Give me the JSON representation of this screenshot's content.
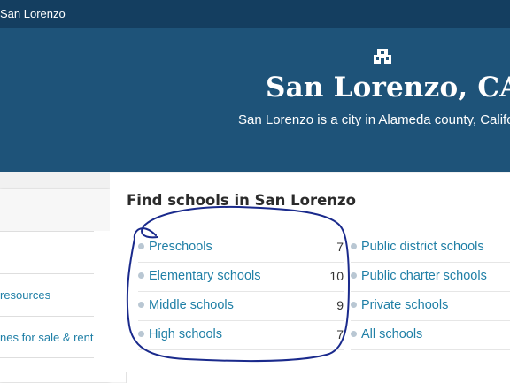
{
  "topbar": {
    "breadcrumb": "San Lorenzo"
  },
  "hero": {
    "icon": "school-building-icon",
    "title": "San Lorenzo, CA",
    "subtitle": "San Lorenzo is a city in Alameda county, Califor"
  },
  "sidebar": {
    "links": [
      "resources",
      "nes for sale & rent"
    ]
  },
  "main": {
    "heading": "Find schools in San Lorenzo",
    "levels": [
      {
        "label": "Preschools",
        "count": "7"
      },
      {
        "label": "Elementary schools",
        "count": "10"
      },
      {
        "label": "Middle schools",
        "count": "9"
      },
      {
        "label": "High schools",
        "count": "7"
      }
    ],
    "types": [
      {
        "label": "Public district schools"
      },
      {
        "label": "Public charter schools"
      },
      {
        "label": "Private schools"
      },
      {
        "label": "All schools"
      }
    ]
  },
  "colors": {
    "topbar": "#143e60",
    "hero": "#1e5379",
    "link": "#1f7fa6",
    "annotation": "#1a2a8c"
  }
}
